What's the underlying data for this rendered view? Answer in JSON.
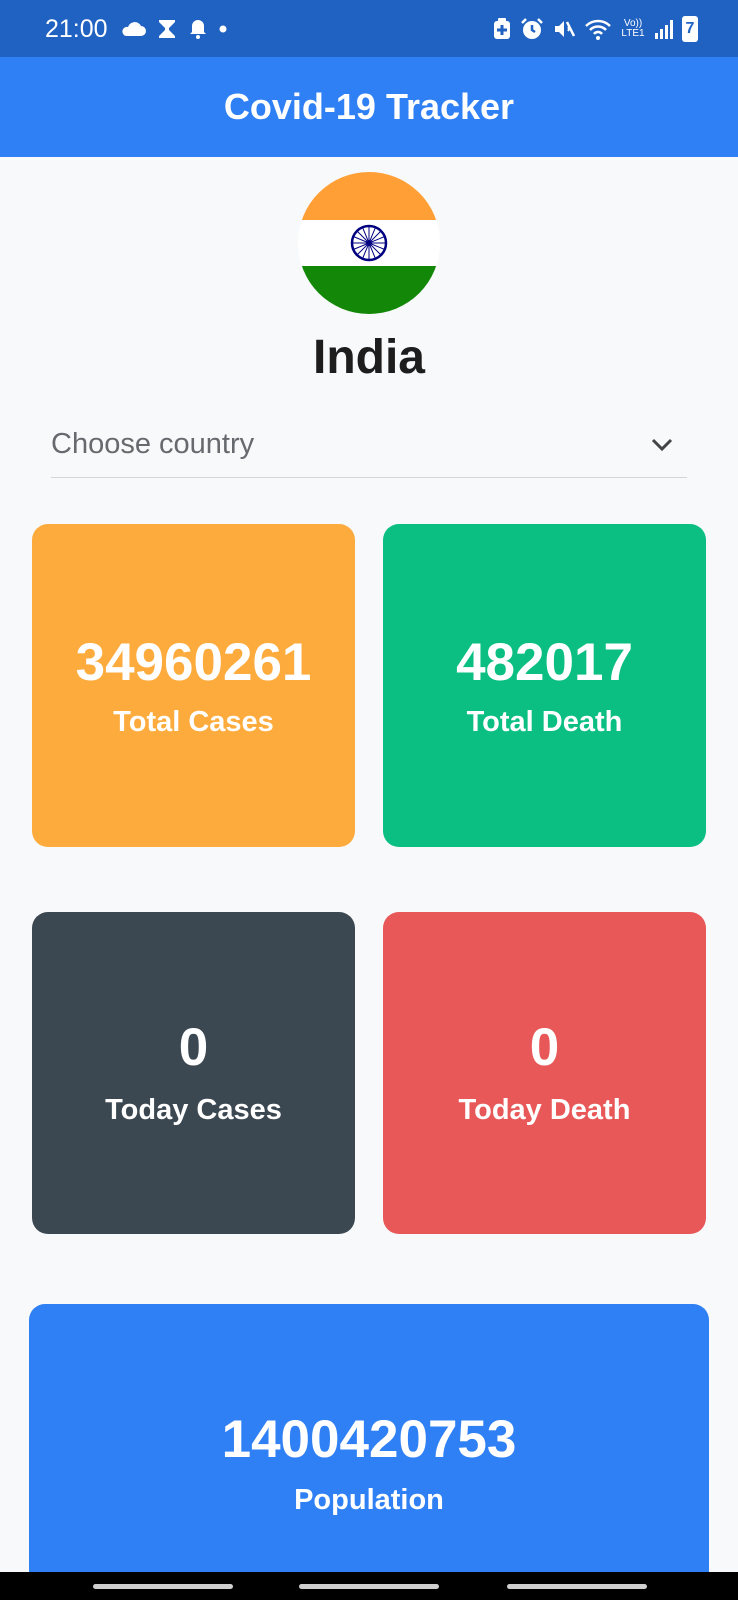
{
  "status_bar": {
    "time": "21:00",
    "network_label": "Vo)) LTE1",
    "battery_level": "7"
  },
  "app_bar": {
    "title": "Covid-19 Tracker"
  },
  "country": {
    "name": "India",
    "flag_colors": [
      "#ff9933",
      "#ffffff",
      "#138808"
    ],
    "chakra_color": "#000080"
  },
  "dropdown": {
    "placeholder": "Choose country"
  },
  "stats": {
    "total_cases": {
      "value": "34960261",
      "label": "Total Cases",
      "color": "#fdab3d"
    },
    "total_death": {
      "value": "482017",
      "label": "Total Death",
      "color": "#0bbf82"
    },
    "today_cases": {
      "value": "0",
      "label": "Today Cases",
      "color": "#3c4851"
    },
    "today_death": {
      "value": "0",
      "label": "Today Death",
      "color": "#e95858"
    },
    "population": {
      "value": "1400420753",
      "label": "Population",
      "color": "#2f80f4"
    }
  },
  "colors": {
    "status_bar": "#2062c2",
    "app_bar": "#2f80f4",
    "background": "#f8f9fb"
  }
}
